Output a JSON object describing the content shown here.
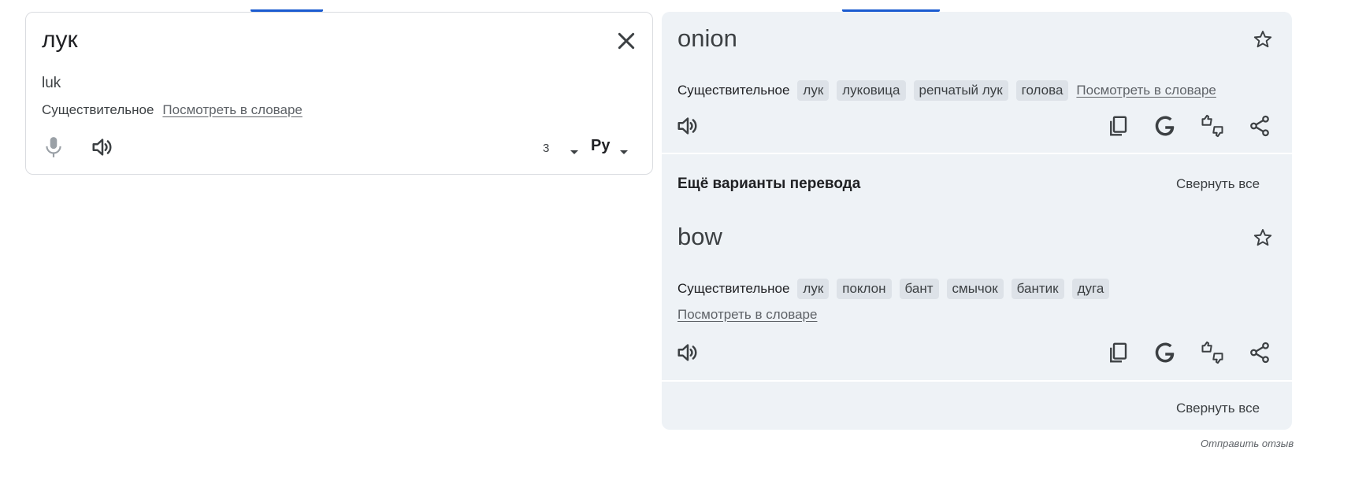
{
  "source": {
    "text": "лук",
    "transliteration": "luk",
    "part_of_speech": "Существительное",
    "dictionary_link": "Посмотреть в словаре",
    "char_count": "3",
    "keyboard_label": "Ру"
  },
  "translation": {
    "primary": {
      "word": "onion",
      "part_of_speech": "Существительное",
      "chips": [
        "лук",
        "луковица",
        "репчатый лук",
        "голова"
      ],
      "dictionary_link": "Посмотреть в словаре"
    },
    "more_title": "Ещё варианты перевода",
    "collapse_label": "Свернуть все",
    "alternative": {
      "word": "bow",
      "part_of_speech": "Существительное",
      "chips": [
        "лук",
        "поклон",
        "бант",
        "смычок",
        "бантик",
        "дуга"
      ],
      "dictionary_link": "Посмотреть в словаре"
    },
    "collapse_label_bottom": "Свернуть все"
  },
  "feedback_link": "Отправить отзыв",
  "icons": [
    "close-icon",
    "microphone-icon",
    "speaker-icon",
    "caret-down-icon",
    "star-icon",
    "copy-icon",
    "google-icon",
    "thumbs-rating-icon",
    "share-icon"
  ],
  "colors": {
    "accent": "#1a5bd0",
    "panel_bg": "#eef2f6",
    "chip_bg": "#dde2e8"
  }
}
